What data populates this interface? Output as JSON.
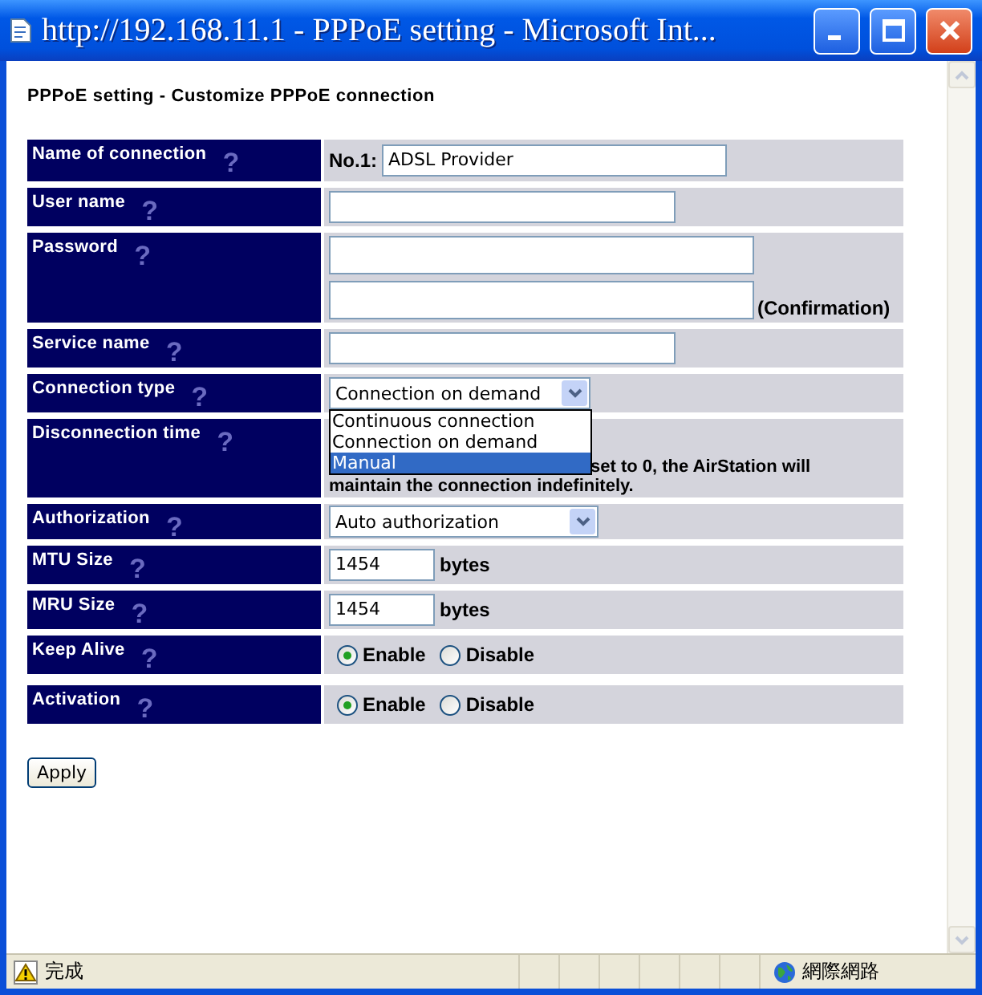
{
  "window": {
    "title": "http://192.168.11.1 - PPPoE setting - Microsoft Int..."
  },
  "heading": "PPPoE setting - Customize PPPoE connection",
  "rows": [
    {
      "kind": "text",
      "label": "Name of connection",
      "help": "?",
      "prefix": "No.1:",
      "value": "ADSL Provider"
    },
    {
      "kind": "text",
      "label": "User name",
      "help": "?"
    },
    {
      "kind": "password",
      "label": "Password",
      "help": "?",
      "suffix": "(Confirmation)"
    },
    {
      "kind": "text",
      "label": "Service name",
      "help": "?"
    },
    {
      "kind": "select",
      "label": "Connection type",
      "help": "?",
      "value": "Connection on demand",
      "expanded": true,
      "options": [
        {
          "label": "Continuous connection",
          "highlighted": false
        },
        {
          "label": "Connection on demand",
          "highlighted": false
        },
        {
          "label": "Manual",
          "highlighted": true
        }
      ]
    },
    {
      "kind": "note",
      "label": "Disconnection time",
      "help": "?",
      "lines": [
        "set to 0, the AirStation will",
        "maintain the connection indefinitely."
      ]
    },
    {
      "kind": "select",
      "label": "Authorization",
      "help": "?",
      "value": "Auto authorization",
      "expanded": false
    },
    {
      "kind": "number",
      "label": "MTU Size",
      "help": "?",
      "value": "1454",
      "unit": "bytes"
    },
    {
      "kind": "number",
      "label": "MRU Size",
      "help": "?",
      "value": "1454",
      "unit": "bytes"
    },
    {
      "kind": "radio",
      "label": "Keep Alive",
      "help": "?",
      "options": [
        {
          "label": "Enable",
          "selected": true
        },
        {
          "label": "Disable",
          "selected": false
        }
      ]
    },
    {
      "kind": "radio",
      "label": "Activation",
      "help": "?",
      "options": [
        {
          "label": "Enable",
          "selected": true
        },
        {
          "label": "Disable",
          "selected": false
        }
      ]
    }
  ],
  "apply_button": "Apply",
  "status_bar": {
    "text": "完成",
    "zone": "網際網路"
  }
}
